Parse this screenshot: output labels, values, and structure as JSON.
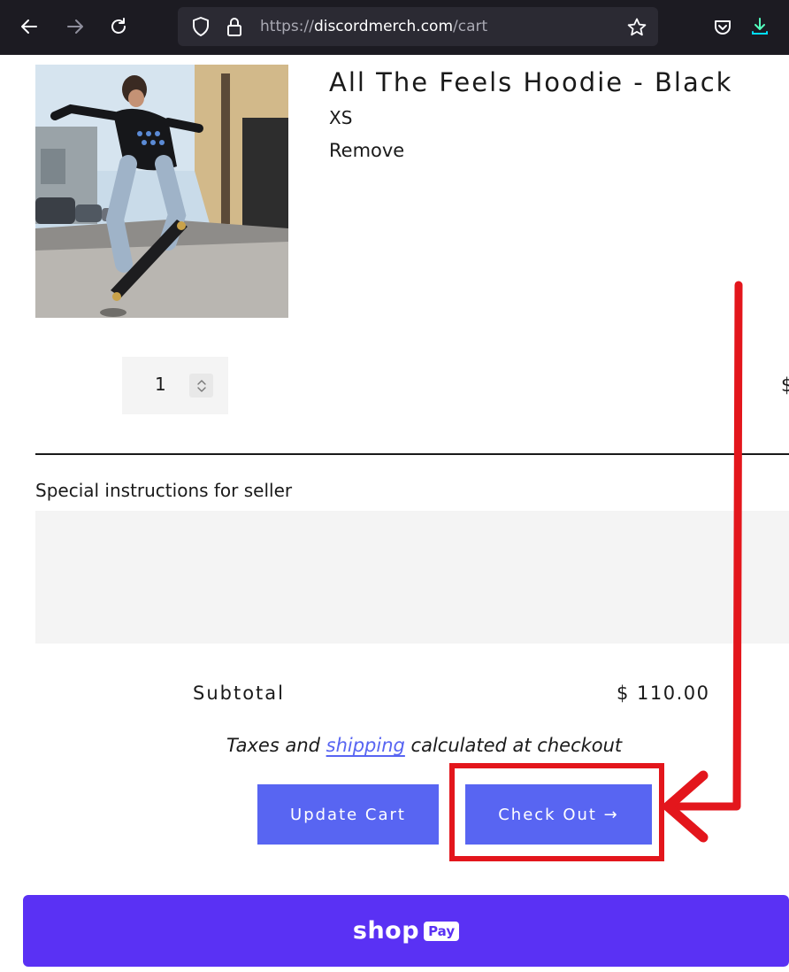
{
  "browser": {
    "url_prefix": "https://",
    "url_domain": "discordmerch.com",
    "url_path": "/cart"
  },
  "cart": {
    "item": {
      "title": "All The Feels Hoodie - Black",
      "variant": "XS",
      "remove_label": "Remove",
      "quantity": "1",
      "price_partial": "$"
    },
    "notes_label": "Special instructions for seller",
    "subtotal_label": "Subtotal",
    "subtotal_value": "$ 110.00",
    "tax_note_before": "Taxes and ",
    "tax_note_link": "shipping",
    "tax_note_after": " calculated at checkout",
    "update_label": "Update Cart",
    "checkout_label": "Check Out →",
    "shoppay_shop": "shop",
    "shoppay_pay": "Pay"
  },
  "colors": {
    "accent": "#5865f2",
    "shoppay": "#5a31f4",
    "annotation": "#e3161c",
    "toolbar": "#1c1b22"
  },
  "icons": [
    "back-arrow-icon",
    "forward-arrow-icon",
    "reload-icon",
    "shield-icon",
    "lock-icon",
    "star-icon",
    "pocket-icon",
    "download-icon",
    "spinner-icon"
  ]
}
